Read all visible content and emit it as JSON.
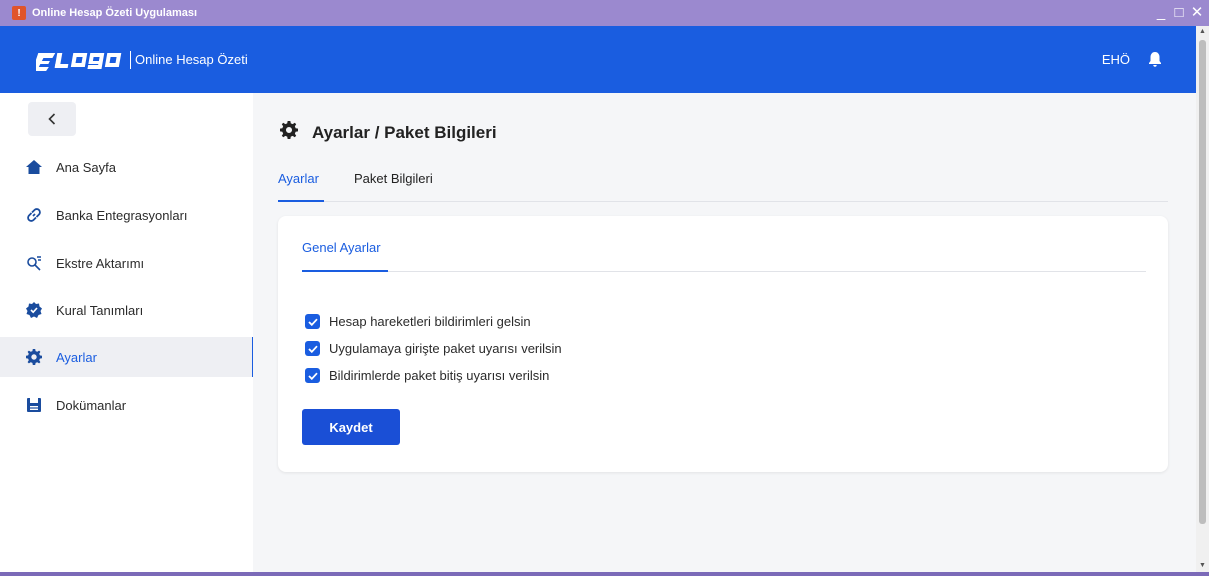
{
  "window": {
    "title": "Online Hesap Özeti Uygulaması",
    "minimize": "_",
    "maximize": "□",
    "close": "✕"
  },
  "header": {
    "logo": "ᴇlogo",
    "app_name": "Online Hesap Özeti",
    "user_initials": "EHÖ",
    "bell_icon": "bell-icon"
  },
  "sidebar": {
    "collapse_label": "‹",
    "items": [
      {
        "label": "Ana Sayfa",
        "icon": "home-icon"
      },
      {
        "label": "Banka Entegrasyonları",
        "icon": "link-icon"
      },
      {
        "label": "Ekstre Aktarımı",
        "icon": "transfer-icon"
      },
      {
        "label": "Kural Tanımları",
        "icon": "badge-check-icon"
      },
      {
        "label": "Ayarlar",
        "icon": "gear-icon",
        "active": true
      },
      {
        "label": "Dokümanlar",
        "icon": "document-icon"
      }
    ]
  },
  "main": {
    "title": "Ayarlar / Paket Bilgileri",
    "tabs": [
      {
        "label": "Ayarlar",
        "active": true
      },
      {
        "label": "Paket Bilgileri",
        "active": false
      }
    ],
    "card": {
      "tab": "Genel Ayarlar",
      "checkboxes": [
        {
          "label": "Hesap hareketleri bildirimleri gelsin",
          "checked": true
        },
        {
          "label": "Uygulamaya girişte paket uyarısı verilsin",
          "checked": true
        },
        {
          "label": "Bildirimlerde paket bitiş uyarısı verilsin",
          "checked": true
        }
      ],
      "save_label": "Kaydet"
    }
  },
  "colors": {
    "accent": "#1a5de0",
    "titlebar": "#9b89cf"
  }
}
